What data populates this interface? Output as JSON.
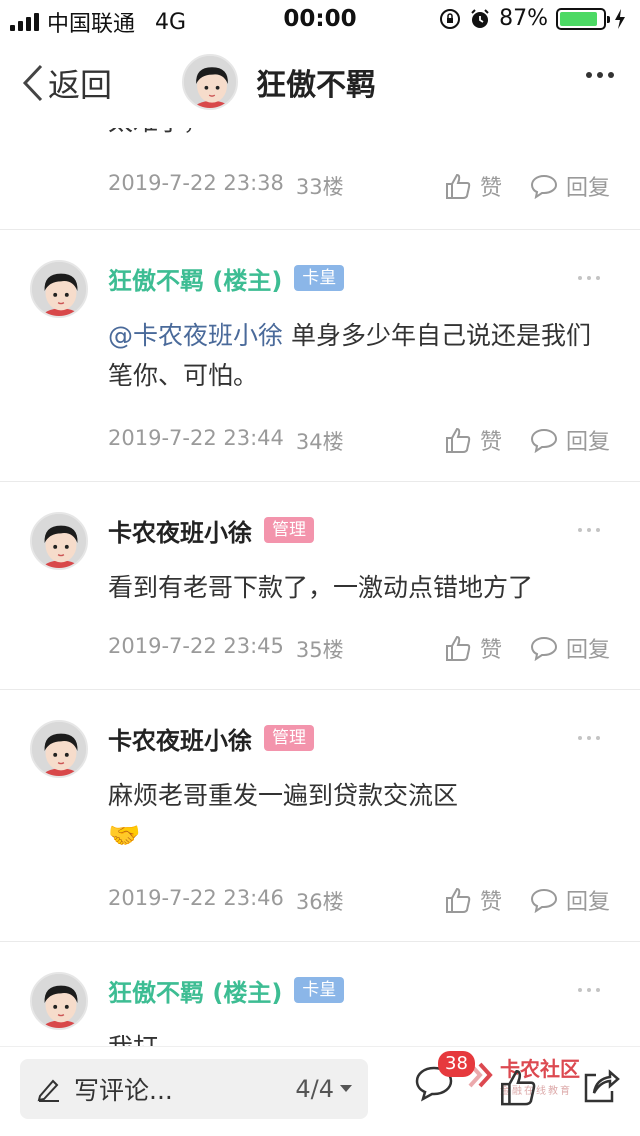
{
  "status_bar": {
    "carrier": "中国联通",
    "network": "4G",
    "time": "00:00",
    "battery": "87%",
    "battery_level": 0.87
  },
  "navbar": {
    "back_label": "返回",
    "title": "狂傲不羁"
  },
  "partial_post": {
    "text_cut": "太难了，",
    "date": "2019-7-22 23:38",
    "floor": "33楼"
  },
  "posts": [
    {
      "author": "狂傲不羁 (楼主)",
      "badge": "卡皇",
      "mention": "@卡农夜班小徐",
      "text": " 单身多少年自己说还是我们笔你、可怕。",
      "date": "2019-7-22 23:44",
      "floor": "34楼"
    },
    {
      "author": "卡农夜班小徐",
      "badge": "管理",
      "text": "看到有老哥下款了，一激动点错地方了",
      "date": "2019-7-22 23:45",
      "floor": "35楼"
    },
    {
      "author": "卡农夜班小徐",
      "badge": "管理",
      "text": "麻烦老哥重发一遍到贷款交流区",
      "emoji": "🤝",
      "date": "2019-7-22 23:46",
      "floor": "36楼"
    },
    {
      "author": "狂傲不羁 (楼主)",
      "badge": "卡皇",
      "text_cut": "我打…"
    }
  ],
  "actions": {
    "like": "赞",
    "reply": "回复"
  },
  "bottom_bar": {
    "placeholder": "写评论...",
    "page": "4/4",
    "comment_count": "38",
    "watermark_title": "卡农社区",
    "watermark_sub": "金融在线教育"
  },
  "colors": {
    "op_name": "#3dbd93",
    "badge_king": "#8bb6e8",
    "badge_admin": "#f394ac",
    "mention": "#4a6a9a",
    "battery": "#4cd964",
    "count_badge": "#e6393d"
  },
  "icons": [
    "back-chevron-icon",
    "more-icon",
    "thumb-up-icon",
    "comment-bubble-icon",
    "pencil-icon",
    "dropdown-arrow-icon",
    "share-icon"
  ]
}
